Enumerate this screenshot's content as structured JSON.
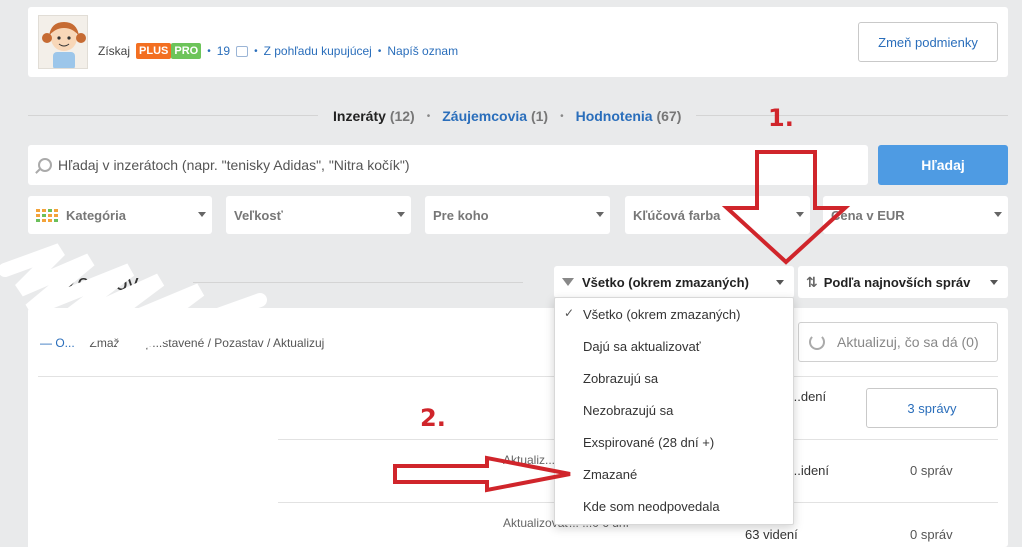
{
  "profile": {
    "get_label": "Získaj",
    "badge_plus": "PLUS",
    "badge_pro": "PRO",
    "likes": "19",
    "link_buyer_view": "Z pohľadu kupujúcej",
    "link_write_ad": "Napíš oznam",
    "change_terms_button": "Zmeň podmienky"
  },
  "tabs": [
    {
      "label": "Inzeráty",
      "count": "(12)"
    },
    {
      "label": "Záujemcovia",
      "count": "(1)"
    },
    {
      "label": "Hodnotenia",
      "count": "(67)"
    }
  ],
  "search": {
    "placeholder": "Hľadaj v inzerátoch (napr. \"tenisky Adidas\", \"Nitra kočík\")",
    "button": "Hľadaj"
  },
  "filters": [
    "Kategória",
    "Veľkosť",
    "Pre koho",
    "Kľúčová farba",
    "Cena v EUR"
  ],
  "list_heading": "...zerátov",
  "status_select": {
    "selected": "Všetko (okrem zmazaných)",
    "options": [
      "Všetko (okrem zmazaných)",
      "Dajú sa aktualizovať",
      "Zobrazujú sa",
      "Nezobrazujú sa",
      "Exspirované (28 dní +)",
      "Zmazané",
      "Kde som neodpovedala"
    ]
  },
  "sort_select": {
    "selected": "Podľa najnovších správ"
  },
  "actions_bar": {
    "select_label": "— O...",
    "text": "• Zmaž / ...j p...stavené / Pozastav / Aktualizuj"
  },
  "refresh_button": "Aktualizuj, čo sa dá (0)",
  "rows": [
    {
      "views": "...dení",
      "messages": "3 správy"
    },
    {
      "status": "Aktualiz...",
      "views": "...idení",
      "messages": "0 správ"
    },
    {
      "status": "Aktualizovať... ...0 6 dní",
      "views": "63 videní",
      "messages": "0 správ"
    }
  ],
  "annotations": {
    "step1": "1.",
    "step2": "2."
  },
  "colors": {
    "accent": "#4e9be3",
    "link": "#2a6ebb",
    "annotation": "#d0252b",
    "plus": "#f36f21",
    "pro": "#6dc45a"
  }
}
